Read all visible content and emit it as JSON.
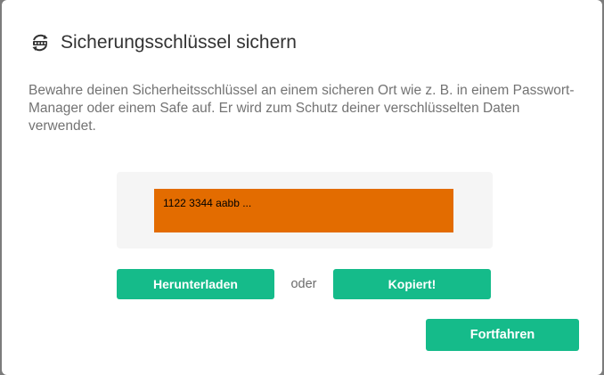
{
  "dialog": {
    "title": "Sicherungsschlüssel sichern",
    "title_icon": "key-sync-icon",
    "description": "Bewahre deinen Sicherheitsschlüssel an einem sicheren Ort wie z. B. in einem Passwort-Manager oder einem Safe auf. Er wird zum Schutz deiner verschlüsselten Daten verwendet.",
    "security_key": "1122 3344 aabb ...",
    "download_label": "Herunterladen",
    "or_label": "oder",
    "copy_label": "Kopiert!",
    "continue_label": "Fortfahren"
  },
  "colors": {
    "accent": "#15bb8a",
    "key_highlight": "#e36c00",
    "key_box_background": "#f5f5f5"
  }
}
